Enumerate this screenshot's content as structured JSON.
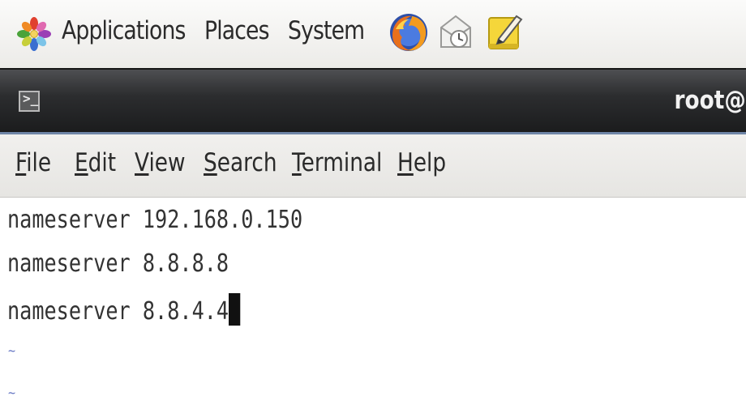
{
  "top_panel": {
    "menus": [
      "Applications",
      "Places",
      "System"
    ],
    "launchers": [
      "firefox-icon",
      "mail-clock-icon",
      "notes-icon"
    ]
  },
  "window": {
    "title": "root@",
    "app_icon": "terminal-icon"
  },
  "menubar": {
    "items": [
      {
        "label": "File",
        "mnemonic": "F",
        "rest": "ile"
      },
      {
        "label": "Edit",
        "mnemonic": "E",
        "rest": "dit"
      },
      {
        "label": "View",
        "mnemonic": "V",
        "rest": "iew"
      },
      {
        "label": "Search",
        "mnemonic": "S",
        "rest": "earch"
      },
      {
        "label": "Terminal",
        "mnemonic": "T",
        "rest": "erminal"
      },
      {
        "label": "Help",
        "mnemonic": "H",
        "rest": "elp"
      }
    ]
  },
  "terminal": {
    "lines": [
      "nameserver 192.168.0.150",
      "nameserver 8.8.8.8",
      "nameserver 8.8.4.4"
    ],
    "empty_line_marker": "~"
  },
  "colors": {
    "title_bar": "#1a1b1c",
    "tilde": "#5a6cbf",
    "terminal_text": "#333333"
  }
}
